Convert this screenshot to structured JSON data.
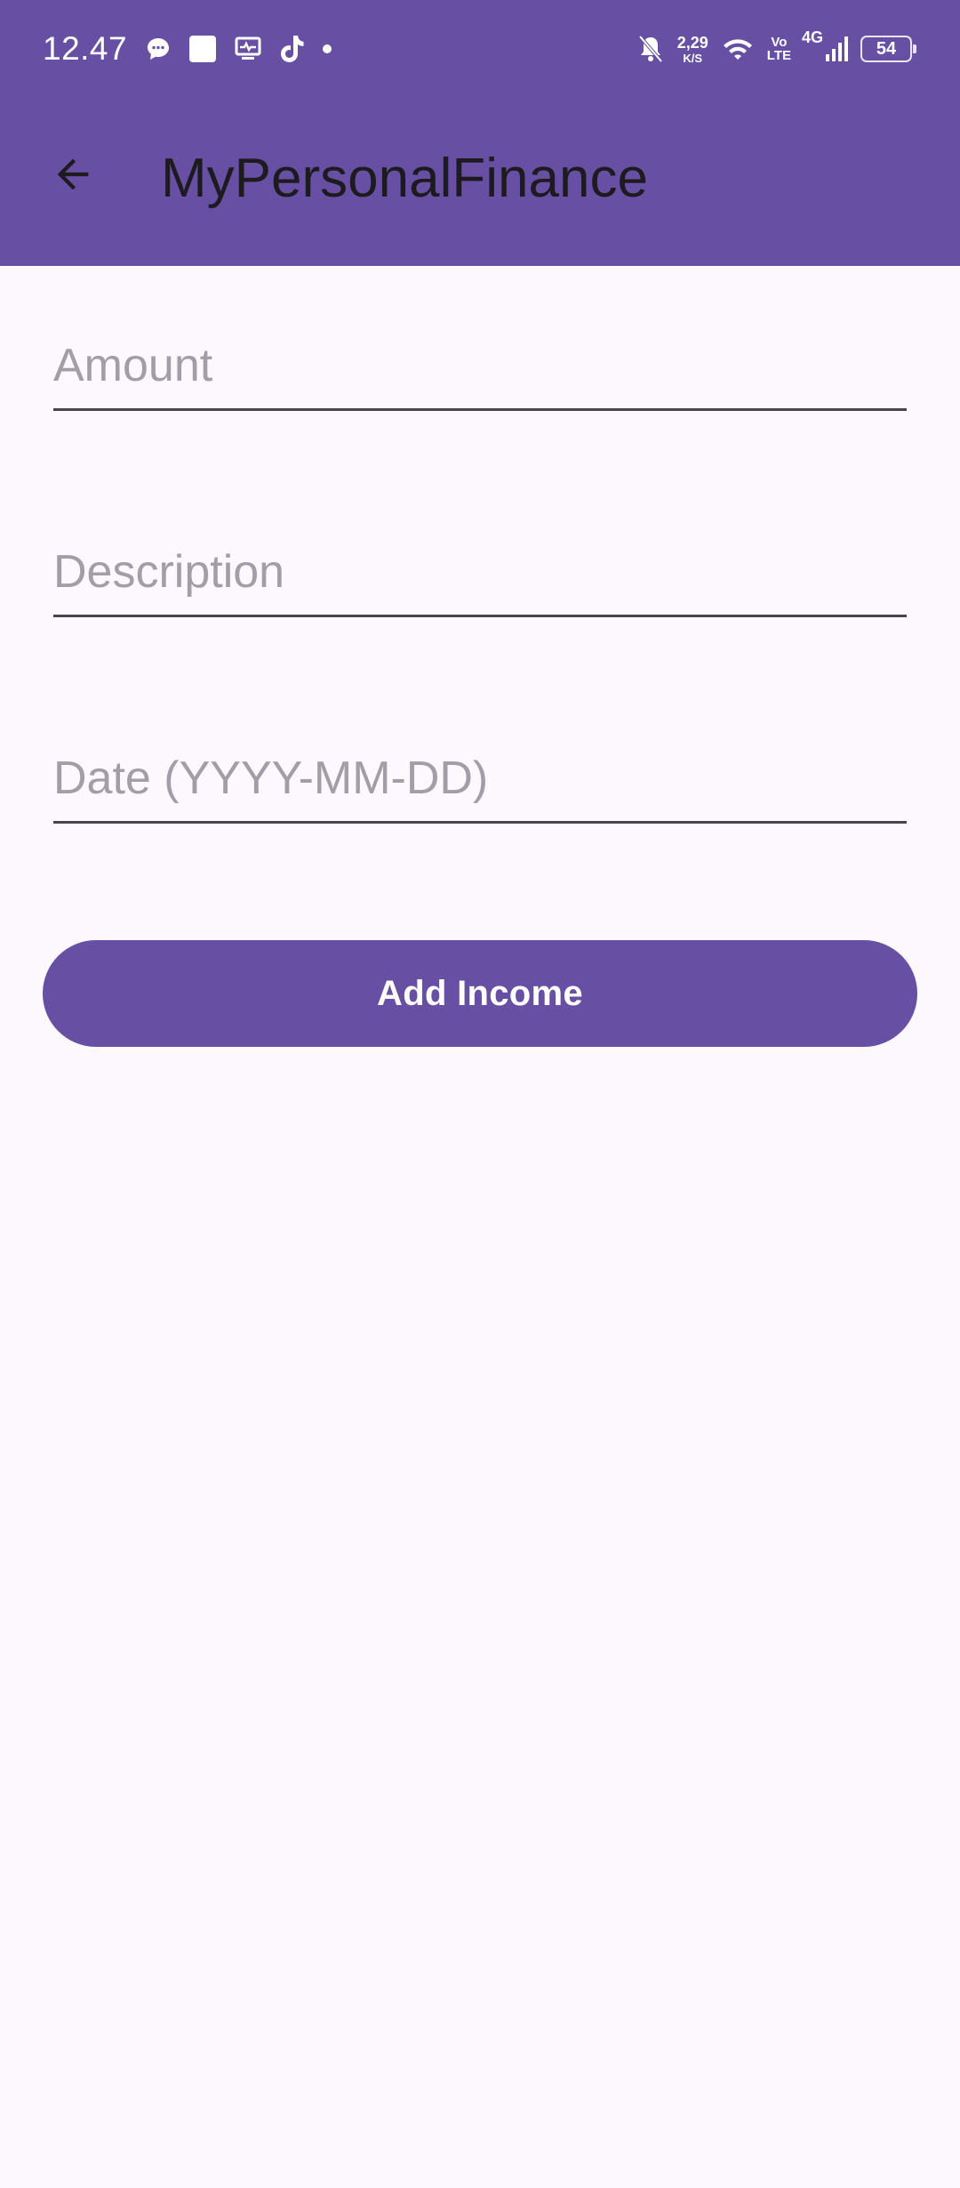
{
  "status_bar": {
    "time": "12.47",
    "net_speed_value": "2,29",
    "net_speed_unit": "K/S",
    "volte_top": "Vo",
    "volte_bottom": "LTE",
    "network_type": "4G",
    "battery_level": "54",
    "icons": [
      "chat-bubble-icon",
      "square-app-icon",
      "health-monitor-icon",
      "tiktok-icon",
      "dot-icon",
      "bell-muted-icon",
      "wifi-icon",
      "signal-icon",
      "battery-icon"
    ]
  },
  "app_bar": {
    "title": "MyPersonalFinance",
    "back_icon": "arrow-back-icon"
  },
  "form": {
    "amount": {
      "placeholder": "Amount",
      "value": ""
    },
    "description": {
      "placeholder": "Description",
      "value": ""
    },
    "date": {
      "placeholder": "Date (YYYY-MM-DD)",
      "value": ""
    },
    "submit_label": "Add Income"
  },
  "colors": {
    "primary": "#6750A4",
    "background": "#FDF7FE",
    "on_surface": "#1D1B20",
    "placeholder": "#A39DA8"
  }
}
